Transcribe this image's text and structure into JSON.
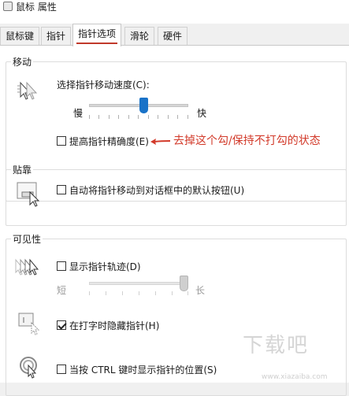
{
  "window": {
    "title": "鼠标 属性"
  },
  "tabs": [
    {
      "label": "鼠标键"
    },
    {
      "label": "指针"
    },
    {
      "label": "指针选项",
      "active": true
    },
    {
      "label": "滑轮"
    },
    {
      "label": "硬件"
    }
  ],
  "motion": {
    "legend": "移动",
    "speed_label": "选择指针移动速度(C):",
    "slow": "慢",
    "fast": "快",
    "speed_level": 0.55,
    "precision": {
      "label": "提高指针精确度(E)",
      "checked": false
    }
  },
  "annotation": {
    "text": "去掉这个勾/保持不打勾的状态",
    "color": "#d23a2a"
  },
  "snap": {
    "legend": "贴靠",
    "option": {
      "label": "自动将指针移动到对话框中的默认按钮(U)",
      "checked": false
    }
  },
  "visibility": {
    "legend": "可见性",
    "trails": {
      "label": "显示指针轨迹(D)",
      "checked": false
    },
    "short": "短",
    "long": "长",
    "trail_level": 1.0,
    "hide_typing": {
      "label": "在打字时隐藏指针(H)",
      "checked": true
    },
    "ctrl_show": {
      "label": "当按 CTRL 键时显示指针的位置(S)",
      "checked": false
    }
  },
  "colors": {
    "accent": "#1a73c8",
    "tab_underline": "#c0392b"
  },
  "watermark": {
    "text": "下载吧",
    "url": "www.xiazaiba.com"
  }
}
